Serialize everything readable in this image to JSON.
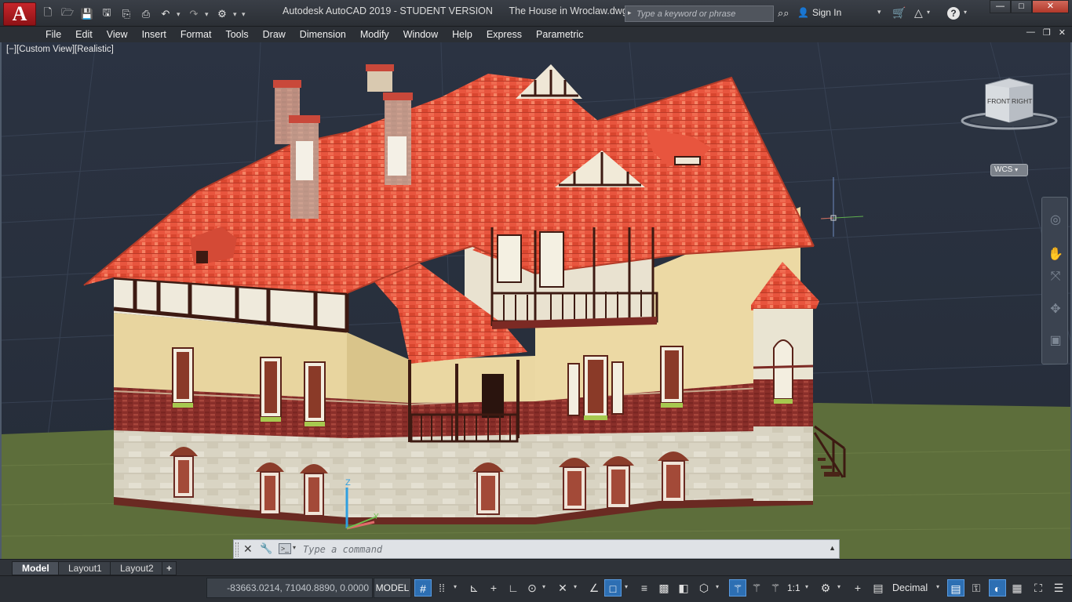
{
  "window": {
    "app_title": "Autodesk AutoCAD 2019 - STUDENT VERSION      The House in Wroclaw.dwg",
    "app_logo": "A",
    "minimize_glyph": "—",
    "maximize_glyph": "□",
    "close_glyph": "✕"
  },
  "quick_access": {
    "new_icon": "new-file-icon",
    "open_icon": "open-folder-icon",
    "save_icon": "save-icon",
    "saveas_icon": "save-as-icon",
    "web_icon": "open-web-icon",
    "plot_icon": "print-icon",
    "undo_icon": "undo-icon",
    "redo_icon": "redo-icon",
    "workspace_icon": "workspace-icon"
  },
  "search": {
    "placeholder": "Type a keyword or phrase"
  },
  "account": {
    "sign_in_label": "Sign In"
  },
  "menu": {
    "items": [
      "File",
      "Edit",
      "View",
      "Insert",
      "Format",
      "Tools",
      "Draw",
      "Dimension",
      "Modify",
      "Window",
      "Help",
      "Express",
      "Parametric"
    ]
  },
  "viewport": {
    "label": "[−][Custom View][Realistic]",
    "viewcube_front": "FRONT",
    "viewcube_right": "RIGHT",
    "wcs_label": "WCS",
    "ucs_z_label": "Z",
    "ucs_y_label": "Y"
  },
  "command_line": {
    "placeholder": "Type a command"
  },
  "layout_tabs": {
    "model": "Model",
    "layout1": "Layout1",
    "layout2": "Layout2",
    "add": "+"
  },
  "status_bar": {
    "coordinates": "-83663.0214, 71040.8890, 0.0000",
    "space": "MODEL",
    "annotation_scale": "1:1",
    "units": "Decimal"
  },
  "colors": {
    "background": "#2a3240",
    "ground": "#5d6e3b",
    "roof_tile": "#e8553e",
    "wall_stucco": "#ead7a2",
    "brick_band": "#8c2e2a",
    "stone_base": "#d8d3c2",
    "timber": "#3d1a12",
    "accent_blue": "#2d6fb3"
  }
}
